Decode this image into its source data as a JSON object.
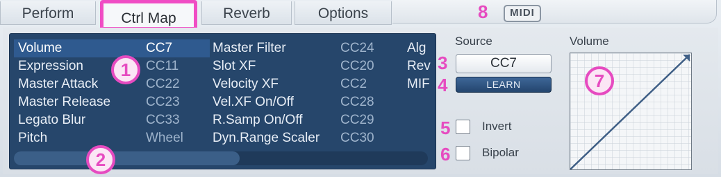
{
  "tabs": [
    {
      "label": "Perform"
    },
    {
      "label": "Ctrl Map"
    },
    {
      "label": "Reverb"
    },
    {
      "label": "Options"
    }
  ],
  "midi_badge": "MIDI",
  "mapping_list": {
    "columns": [
      {
        "rows": [
          {
            "name": "Volume",
            "cc": "CC7",
            "selected": true
          },
          {
            "name": "Expression",
            "cc": "CC11"
          },
          {
            "name": "Master Attack",
            "cc": "CC22"
          },
          {
            "name": "Master Release",
            "cc": "CC23"
          },
          {
            "name": "Legato Blur",
            "cc": "CC33"
          },
          {
            "name": "Pitch",
            "cc": "Wheel"
          }
        ]
      },
      {
        "rows": [
          {
            "name": "Master Filter",
            "cc": "CC24"
          },
          {
            "name": "Slot XF",
            "cc": "CC20"
          },
          {
            "name": "Velocity XF",
            "cc": "CC2"
          },
          {
            "name": "Vel.XF On/Off",
            "cc": "CC28"
          },
          {
            "name": "R.Samp On/Off",
            "cc": "CC29"
          },
          {
            "name": "Dyn.Range Scaler",
            "cc": "CC30"
          }
        ]
      },
      {
        "rows": [
          {
            "name": "Alg"
          },
          {
            "name": "Rev"
          },
          {
            "name": "MIF"
          }
        ]
      }
    ]
  },
  "source": {
    "label": "Source",
    "value": "CC7",
    "learn_label": "LEARN"
  },
  "options": {
    "invert_label": "Invert",
    "invert_checked": false,
    "bipolar_label": "Bipolar",
    "bipolar_checked": false
  },
  "curve": {
    "label": "Volume"
  },
  "annotations": {
    "n1": "1",
    "n2": "2",
    "n3": "3",
    "n4": "4",
    "n5": "5",
    "n6": "6",
    "n7": "7",
    "n8": "8"
  },
  "colors": {
    "annotation": "#e64bc0",
    "list_bg": "#26466b",
    "selected_row": "#2f5a8f"
  }
}
